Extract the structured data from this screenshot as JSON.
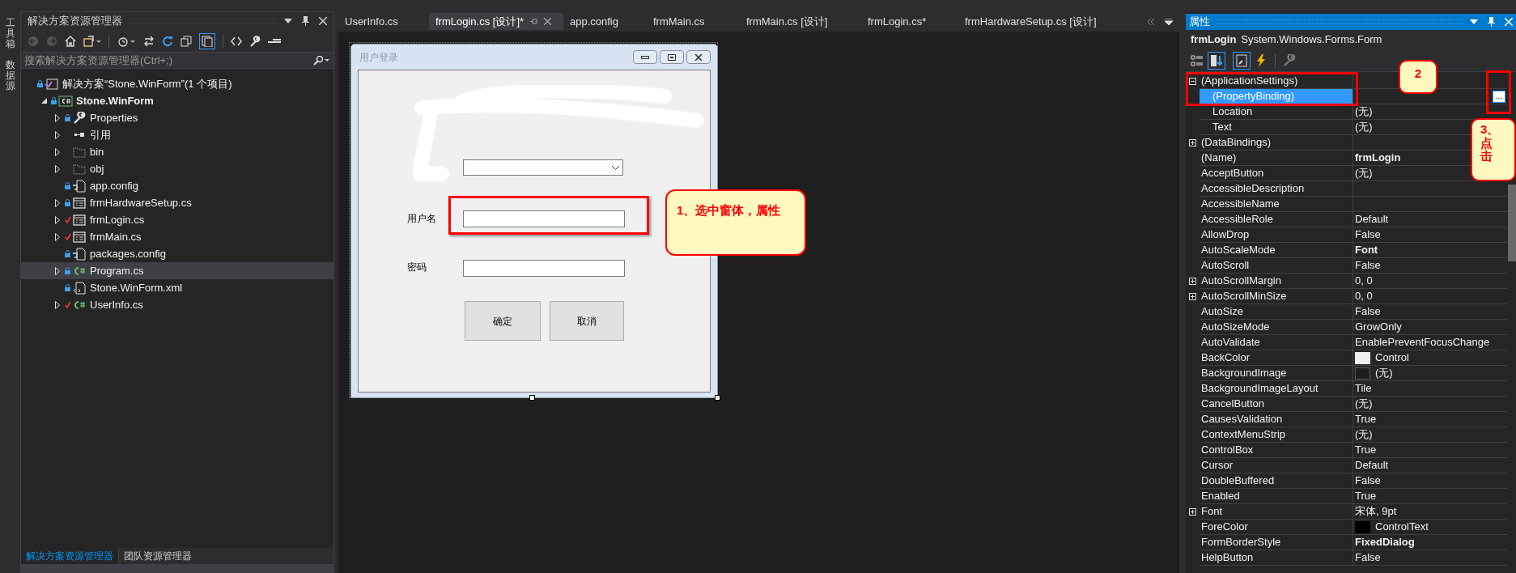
{
  "side_strip": [
    "工具箱",
    "数据源"
  ],
  "solution_explorer": {
    "title": "解决方案资源管理器",
    "search": {
      "placeholder": "搜索解决方案资源管理器(Ctrl+;)"
    },
    "tree": [
      {
        "label": "解决方案“Stone.WinForm”(1 个项目)",
        "kind": "solution",
        "locked": true,
        "selected": false,
        "children": [
          {
            "label": "Stone.WinForm",
            "kind": "project",
            "locked": true,
            "bold": true,
            "expanded": true,
            "selected": false,
            "children": [
              {
                "label": "Properties",
                "kind": "properties",
                "locked": true,
                "expanded": false,
                "selected": false
              },
              {
                "label": "引用",
                "kind": "references",
                "expanded": false,
                "selected": false
              },
              {
                "label": "bin",
                "kind": "folder",
                "expanded": false,
                "selected": false
              },
              {
                "label": "obj",
                "kind": "folder",
                "expanded": false,
                "selected": false
              },
              {
                "label": "app.config",
                "kind": "config",
                "locked": true,
                "selected": false
              },
              {
                "label": "frmHardwareSetup.cs",
                "kind": "form",
                "locked": true,
                "expanded": false,
                "selected": false
              },
              {
                "label": "frmLogin.cs",
                "kind": "form",
                "edited": true,
                "expanded": false,
                "selected": false
              },
              {
                "label": "frmMain.cs",
                "kind": "form",
                "edited": true,
                "expanded": false,
                "selected": false
              },
              {
                "label": "packages.config",
                "kind": "config",
                "locked": true,
                "selected": false
              },
              {
                "label": "Program.cs",
                "kind": "code",
                "locked": true,
                "expanded": false,
                "selected": true
              },
              {
                "label": "Stone.WinForm.xml",
                "kind": "xml",
                "locked": true,
                "selected": false
              },
              {
                "label": "UserInfo.cs",
                "kind": "code",
                "edited": true,
                "expanded": false,
                "selected": false
              }
            ]
          }
        ]
      }
    ],
    "bottom_tabs": [
      {
        "label": "解决方案资源管理器",
        "selected": true
      },
      {
        "label": "团队资源管理器",
        "selected": false
      }
    ]
  },
  "editor_tabs": [
    {
      "label": "UserInfo.cs",
      "selected": false
    },
    {
      "label": "frmLogin.cs [设计]*",
      "selected": true
    },
    {
      "label": "app.config",
      "selected": false
    },
    {
      "label": "frmMain.cs",
      "selected": false
    },
    {
      "label": "frmMain.cs [设计]",
      "selected": false
    },
    {
      "label": "frmLogin.cs*",
      "selected": false
    },
    {
      "label": "frmHardwareSetup.cs [设计]",
      "selected": false
    }
  ],
  "form": {
    "title": "用户登录",
    "username_label": "用户名",
    "password_label": "密码",
    "buttons": [
      "确定",
      "取消"
    ]
  },
  "callouts": [
    "1、选中窗体，属性",
    "2",
    "3、点击"
  ],
  "properties": {
    "title": "属性",
    "object_name": "frmLogin",
    "object_type": "System.Windows.Forms.Form",
    "rows": [
      {
        "name": "(ApplicationSettings)",
        "expanded": true,
        "selected": false,
        "children": [
          {
            "name": "(PropertyBinding)",
            "selected": true,
            "button": "..."
          },
          {
            "name": "Location",
            "value": "(无)",
            "selected": false
          },
          {
            "name": "Text",
            "value": "(无)",
            "selected": false
          }
        ]
      },
      {
        "name": "(DataBindings)",
        "expanded": false,
        "selected": false
      },
      {
        "name": "(Name)",
        "value": "frmLogin",
        "bold": true,
        "selected": false
      },
      {
        "name": "AcceptButton",
        "value": "(无)",
        "selected": false
      },
      {
        "name": "AccessibleDescription",
        "selected": false
      },
      {
        "name": "AccessibleName",
        "selected": false
      },
      {
        "name": "AccessibleRole",
        "value": "Default",
        "selected": false
      },
      {
        "name": "AllowDrop",
        "value": "False",
        "selected": false
      },
      {
        "name": "AutoScaleMode",
        "value": "Font",
        "bold": true,
        "selected": false
      },
      {
        "name": "AutoScroll",
        "value": "False",
        "selected": false
      },
      {
        "name": "AutoScrollMargin",
        "value": "0, 0",
        "expanded": false,
        "selected": false
      },
      {
        "name": "AutoScrollMinSize",
        "value": "0, 0",
        "expanded": false,
        "selected": false
      },
      {
        "name": "AutoSize",
        "value": "False",
        "selected": false
      },
      {
        "name": "AutoSizeMode",
        "value": "GrowOnly",
        "selected": false
      },
      {
        "name": "AutoValidate",
        "value": "EnablePreventFocusChange",
        "selected": false
      },
      {
        "name": "BackColor",
        "value": "Control",
        "color": "#f0f0f0",
        "selected": false
      },
      {
        "name": "BackgroundImage",
        "value": "(无)",
        "empty_image": true,
        "selected": false
      },
      {
        "name": "BackgroundImageLayout",
        "value": "Tile",
        "selected": false
      },
      {
        "name": "CancelButton",
        "value": "(无)",
        "selected": false
      },
      {
        "name": "CausesValidation",
        "value": "True",
        "selected": false
      },
      {
        "name": "ContextMenuStrip",
        "value": "(无)",
        "selected": false
      },
      {
        "name": "ControlBox",
        "value": "True",
        "selected": false
      },
      {
        "name": "Cursor",
        "value": "Default",
        "selected": false
      },
      {
        "name": "DoubleBuffered",
        "value": "False",
        "selected": false
      },
      {
        "name": "Enabled",
        "value": "True",
        "selected": false
      },
      {
        "name": "Font",
        "value": "宋体, 9pt",
        "expanded": false,
        "selected": false
      },
      {
        "name": "ForeColor",
        "value": "ControlText",
        "color": "#000000",
        "selected": false
      },
      {
        "name": "FormBorderStyle",
        "value": "FixedDialog",
        "bold": true,
        "selected": false
      },
      {
        "name": "HelpButton",
        "value": "False",
        "selected": false
      }
    ]
  }
}
